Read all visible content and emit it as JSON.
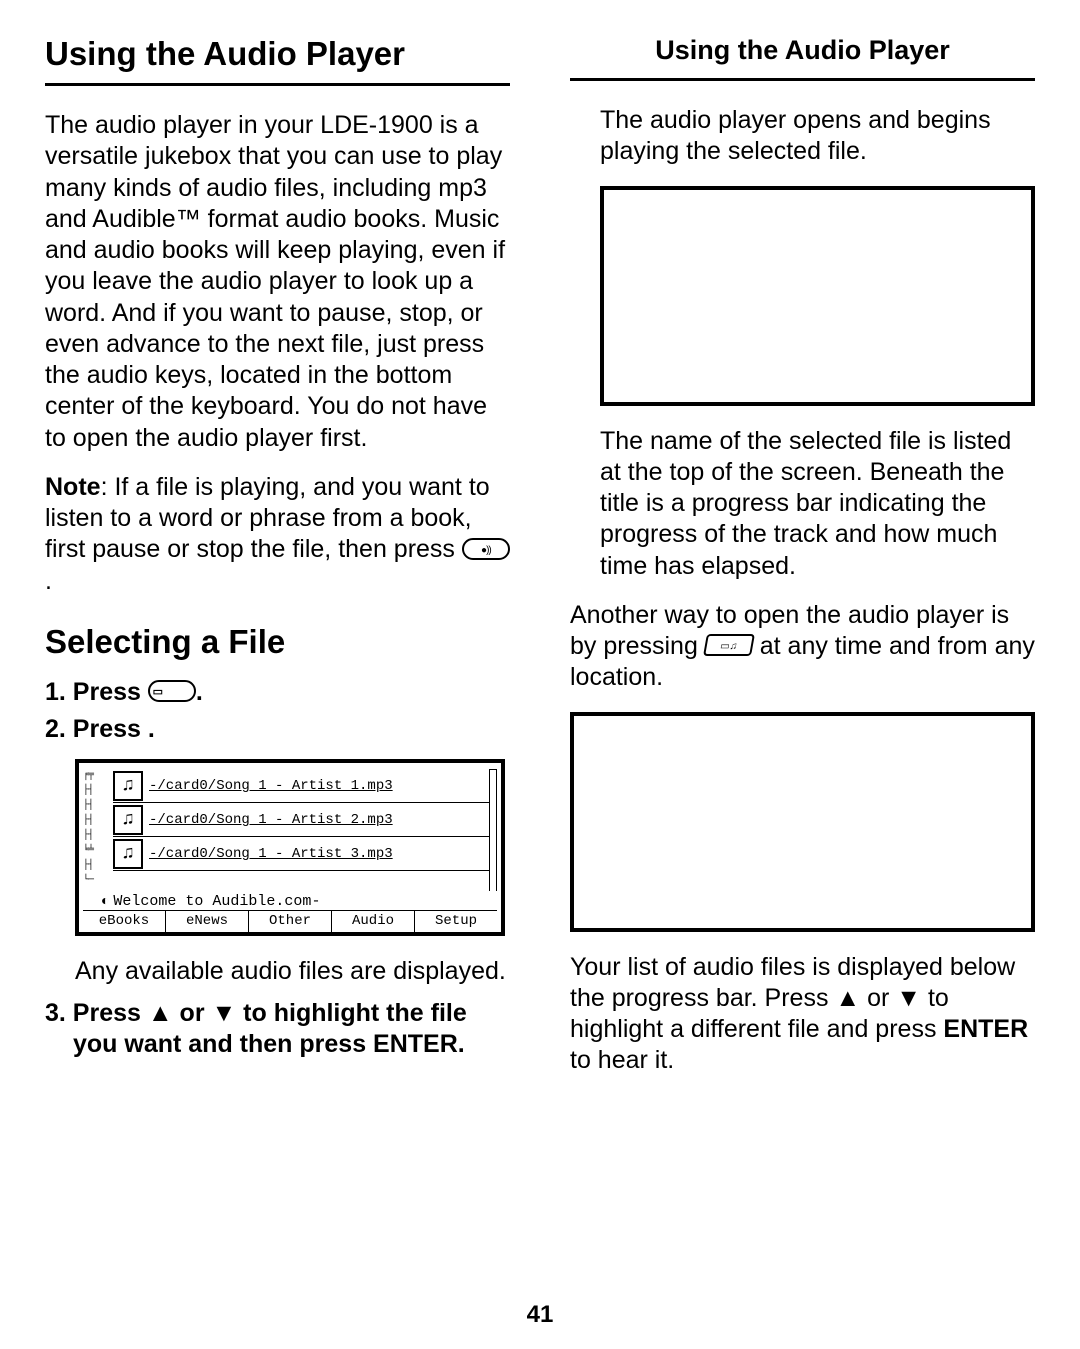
{
  "left": {
    "title": "Using the Audio Player",
    "intro": "The audio player in your LDE-1900 is a versatile jukebox that you can use to play many kinds of audio files, including mp3 and Audible™ format audio books. Music and audio books will keep playing, even if you leave the audio player to look up a word. And if you want to pause, stop, or even advance to the next file, just press the audio keys, located in the bottom center of the keyboard. You do not have to open the audio player first.",
    "note_label": "Note",
    "note_text": ": If a file is playing, and you want to listen to a word or phrase from a book, first pause or stop the file, then press ",
    "note_end": ".",
    "sub_heading": "Selecting a File",
    "step1": "1. Press ",
    "step1_end": ".",
    "step2": "2. Press          .",
    "step2_after": "Any available audio files are displayed.",
    "step3": "3. Press ▲ or ▼ to highlight the file you want and then press ENTER.",
    "screen": {
      "files": [
        "-/card0/Song 1 - Artist 1.mp3",
        "-/card0/Song 1 - Artist 2.mp3",
        "-/card0/Song 1 - Artist 3.mp3"
      ],
      "status": "Welcome to Audible.com-",
      "tabs": [
        "eBooks",
        "eNews",
        "Other",
        "Audio",
        "Setup"
      ]
    }
  },
  "right": {
    "title": "Using the Audio Player",
    "p1": "The audio player opens and begins playing the selected file.",
    "p2": "The name of the selected file is listed at the top of the screen. Beneath the title is a progress bar indicating the progress of the track and how much time has elapsed.",
    "p3_a": "Another way to open the audio player is by pressing ",
    "p3_b": " at any time and from any location.",
    "p4_a": "Your list of audio files is displayed below the progress bar. Press ▲ or ▼ to highlight a different file and press ",
    "p4_enter": "ENTER",
    "p4_b": " to hear it."
  },
  "page_number": "41"
}
